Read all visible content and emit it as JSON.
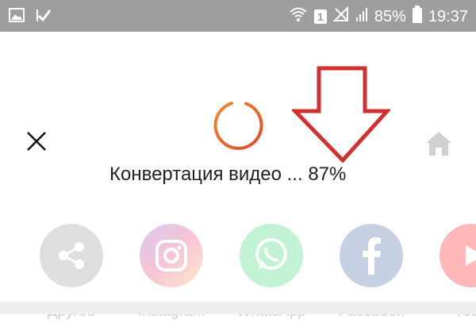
{
  "status_bar": {
    "battery": "85%",
    "time": "19:37",
    "sim": "1",
    "icons": [
      "image-icon",
      "check-flag-icon",
      "wifi-icon",
      "sim-icon",
      "no-signal-icon",
      "signal-icon",
      "battery-icon"
    ]
  },
  "toolbar": {
    "close_icon": "close-icon",
    "home_icon": "home-icon"
  },
  "conversion": {
    "label": "Конвертация видео ... 87%",
    "progress": 0.87
  },
  "share_targets": [
    {
      "label": "Другое",
      "icon": "share-icon",
      "color": "#7f7f7f"
    },
    {
      "label": "Instagram",
      "icon": "instagram-icon",
      "color": "#c13584"
    },
    {
      "label": "WhatsApp",
      "icon": "whatsapp-icon",
      "color": "#25d366"
    },
    {
      "label": "Facebook",
      "icon": "facebook-icon",
      "color": "#3b5998"
    },
    {
      "label": "YouT",
      "icon": "youtube-icon",
      "color": "#ff0000"
    }
  ],
  "colors": {
    "status_bar": "#9e9e9e",
    "spinner": "#e8562a",
    "annotation_arrow": "#d32f2f"
  }
}
